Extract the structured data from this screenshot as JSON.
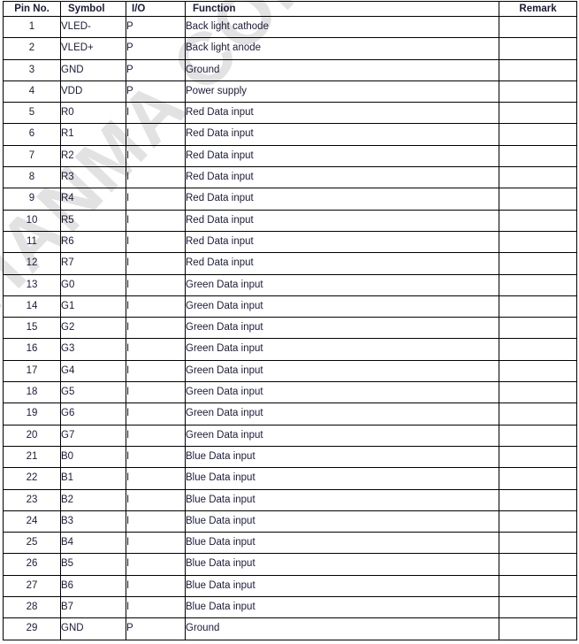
{
  "document": {
    "watermark": "TIANMA CONFIDENTIAL",
    "watermark_color": "#e2e2e2",
    "text_color": "#1b1b3a",
    "border_color": "#000000",
    "background_color": "#ffffff"
  },
  "table": {
    "headers": {
      "pin": "Pin No.",
      "symbol": "Symbol",
      "io": "I/O",
      "function": "Function",
      "remark": "Remark"
    },
    "rows": [
      {
        "pin": "1",
        "symbol": "VLED-",
        "io": "P",
        "function": "Back light cathode",
        "remark": ""
      },
      {
        "pin": "2",
        "symbol": "VLED+",
        "io": "P",
        "function": "Back light anode",
        "remark": ""
      },
      {
        "pin": "3",
        "symbol": "GND",
        "io": "P",
        "function": "Ground",
        "remark": ""
      },
      {
        "pin": "4",
        "symbol": "VDD",
        "io": "P",
        "function": "Power supply",
        "remark": ""
      },
      {
        "pin": "5",
        "symbol": "R0",
        "io": "I",
        "function": "Red Data input",
        "remark": ""
      },
      {
        "pin": "6",
        "symbol": "R1",
        "io": "I",
        "function": "Red Data input",
        "remark": ""
      },
      {
        "pin": "7",
        "symbol": "R2",
        "io": "I",
        "function": "Red Data input",
        "remark": ""
      },
      {
        "pin": "8",
        "symbol": "R3",
        "io": "I",
        "function": "Red Data input",
        "remark": ""
      },
      {
        "pin": "9",
        "symbol": "R4",
        "io": "I",
        "function": "Red Data input",
        "remark": ""
      },
      {
        "pin": "10",
        "symbol": "R5",
        "io": "I",
        "function": "Red Data input",
        "remark": ""
      },
      {
        "pin": "11",
        "symbol": "R6",
        "io": "I",
        "function": "Red Data input",
        "remark": ""
      },
      {
        "pin": "12",
        "symbol": "R7",
        "io": "I",
        "function": "Red Data input",
        "remark": ""
      },
      {
        "pin": "13",
        "symbol": "G0",
        "io": "I",
        "function": "Green Data input",
        "remark": ""
      },
      {
        "pin": "14",
        "symbol": "G1",
        "io": "I",
        "function": "Green Data input",
        "remark": ""
      },
      {
        "pin": "15",
        "symbol": "G2",
        "io": "I",
        "function": "Green Data input",
        "remark": ""
      },
      {
        "pin": "16",
        "symbol": "G3",
        "io": "I",
        "function": "Green Data input",
        "remark": ""
      },
      {
        "pin": "17",
        "symbol": "G4",
        "io": "I",
        "function": "Green Data input",
        "remark": ""
      },
      {
        "pin": "18",
        "symbol": "G5",
        "io": "I",
        "function": "Green Data input",
        "remark": ""
      },
      {
        "pin": "19",
        "symbol": "G6",
        "io": "I",
        "function": "Green Data input",
        "remark": ""
      },
      {
        "pin": "20",
        "symbol": "G7",
        "io": "I",
        "function": "Green Data input",
        "remark": ""
      },
      {
        "pin": "21",
        "symbol": "B0",
        "io": "I",
        "function": "Blue Data input",
        "remark": ""
      },
      {
        "pin": "22",
        "symbol": "B1",
        "io": "I",
        "function": "Blue Data input",
        "remark": ""
      },
      {
        "pin": "23",
        "symbol": "B2",
        "io": "I",
        "function": "Blue Data input",
        "remark": ""
      },
      {
        "pin": "24",
        "symbol": "B3",
        "io": "I",
        "function": "Blue Data input",
        "remark": ""
      },
      {
        "pin": "25",
        "symbol": "B4",
        "io": "I",
        "function": "Blue Data input",
        "remark": ""
      },
      {
        "pin": "26",
        "symbol": "B5",
        "io": "I",
        "function": "Blue Data input",
        "remark": ""
      },
      {
        "pin": "27",
        "symbol": "B6",
        "io": "I",
        "function": "Blue Data input",
        "remark": ""
      },
      {
        "pin": "28",
        "symbol": "B7",
        "io": "I",
        "function": "Blue Data input",
        "remark": ""
      },
      {
        "pin": "29",
        "symbol": "GND",
        "io": "P",
        "function": "Ground",
        "remark": ""
      }
    ]
  }
}
